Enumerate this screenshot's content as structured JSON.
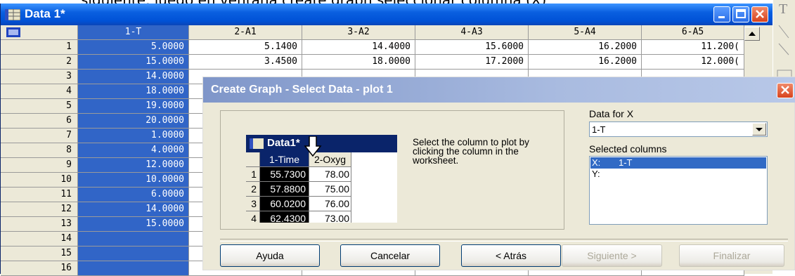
{
  "caption": "siguiente, luego en ventana create graph seleccionar columna (X)",
  "worksheet": {
    "title": "Data 1*",
    "columns": [
      "1-T",
      "2-A1",
      "3-A2",
      "4-A3",
      "5-A4",
      "6-A5"
    ],
    "rows": [
      {
        "n": "1",
        "v": [
          "5.0000",
          "5.1400",
          "14.4000",
          "15.6000",
          "16.2000",
          "11.200("
        ]
      },
      {
        "n": "2",
        "v": [
          "15.0000",
          "3.4500",
          "18.0000",
          "17.2000",
          "16.2000",
          "12.000("
        ]
      },
      {
        "n": "3",
        "v": [
          "14.0000"
        ]
      },
      {
        "n": "4",
        "v": [
          "18.0000"
        ]
      },
      {
        "n": "5",
        "v": [
          "19.0000"
        ]
      },
      {
        "n": "6",
        "v": [
          "20.0000"
        ]
      },
      {
        "n": "7",
        "v": [
          "1.0000"
        ]
      },
      {
        "n": "8",
        "v": [
          "4.0000"
        ]
      },
      {
        "n": "9",
        "v": [
          "12.0000"
        ]
      },
      {
        "n": "10",
        "v": [
          "10.0000"
        ]
      },
      {
        "n": "11",
        "v": [
          "6.0000"
        ]
      },
      {
        "n": "12",
        "v": [
          "14.0000"
        ]
      },
      {
        "n": "13",
        "v": [
          "15.0000"
        ]
      },
      {
        "n": "14",
        "v": [
          ""
        ]
      },
      {
        "n": "15",
        "v": [
          ""
        ]
      },
      {
        "n": "16",
        "v": [
          ""
        ]
      }
    ]
  },
  "side_tool_letter": "T",
  "dialog": {
    "title": "Create Graph - Select Data - plot 1",
    "instructions": "Select the column to plot by clicking the column in the worksheet.",
    "data_for_x_label": "Data for X",
    "data_for_x_value": "1-T",
    "selected_columns_label": "Selected columns",
    "selected_columns": [
      {
        "axis": "X:",
        "col": "1-T",
        "selected": true
      },
      {
        "axis": "Y:",
        "col": "",
        "selected": false
      }
    ],
    "buttons": {
      "help": "Ayuda",
      "cancel": "Cancelar",
      "back": "< Atrás",
      "next": "Siguiente >",
      "finish": "Finalizar"
    },
    "mini_sheet": {
      "title": "Data1*",
      "headers": [
        "1-Time",
        "2-Oxyg"
      ],
      "rows": [
        {
          "n": "1",
          "a": "55.7300",
          "b": "78.00"
        },
        {
          "n": "2",
          "a": "57.8800",
          "b": "75.00"
        },
        {
          "n": "3",
          "a": "60.0200",
          "b": "76.00"
        },
        {
          "n": "4",
          "a": "62.4300",
          "b": "73.00"
        }
      ]
    }
  }
}
